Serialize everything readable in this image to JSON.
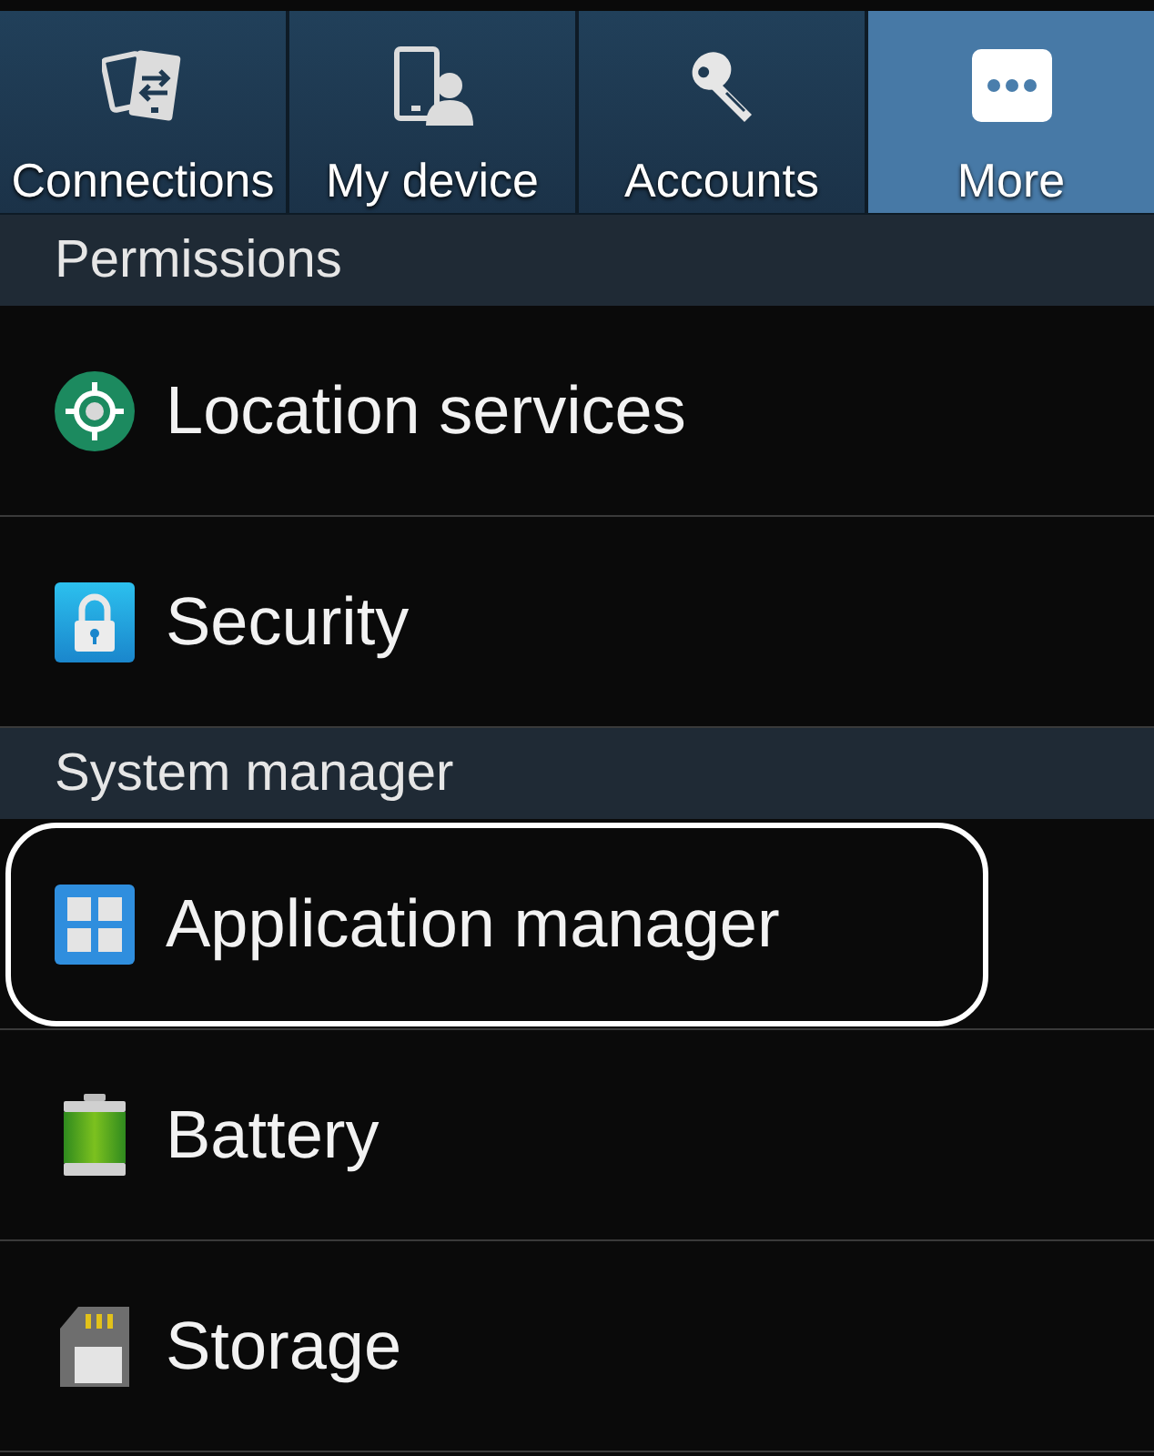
{
  "tabs": [
    {
      "label": "Connections",
      "kind": "connections",
      "selected": false
    },
    {
      "label": "My device",
      "kind": "device",
      "selected": false
    },
    {
      "label": "Accounts",
      "kind": "accounts",
      "selected": false
    },
    {
      "label": "More",
      "kind": "more",
      "selected": true
    }
  ],
  "sections": [
    {
      "title": "Permissions",
      "items": [
        {
          "label": "Location services",
          "kind": "location",
          "highlighted": false
        },
        {
          "label": "Security",
          "kind": "security",
          "highlighted": false
        }
      ]
    },
    {
      "title": "System manager",
      "items": [
        {
          "label": "Application manager",
          "kind": "apps",
          "highlighted": true
        },
        {
          "label": "Battery",
          "kind": "battery",
          "highlighted": false
        },
        {
          "label": "Storage",
          "kind": "storage",
          "highlighted": false
        }
      ]
    }
  ]
}
